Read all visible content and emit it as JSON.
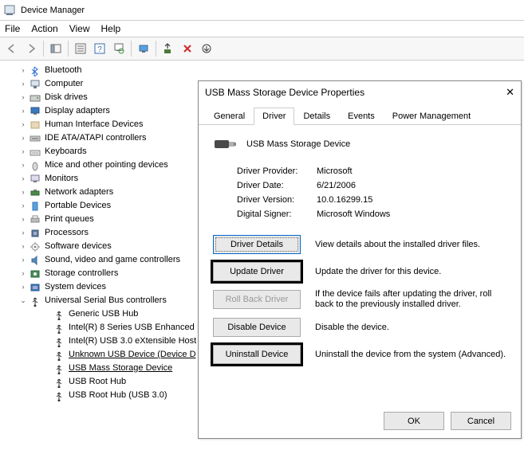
{
  "window": {
    "title": "Device Manager"
  },
  "menu": {
    "file": "File",
    "action": "Action",
    "view": "View",
    "help": "Help"
  },
  "tree": {
    "items": [
      {
        "label": "Bluetooth",
        "icon": "bluetooth"
      },
      {
        "label": "Computer",
        "icon": "computer"
      },
      {
        "label": "Disk drives",
        "icon": "disk"
      },
      {
        "label": "Display adapters",
        "icon": "display"
      },
      {
        "label": "Human Interface Devices",
        "icon": "hid"
      },
      {
        "label": "IDE ATA/ATAPI controllers",
        "icon": "ide"
      },
      {
        "label": "Keyboards",
        "icon": "keyboard"
      },
      {
        "label": "Mice and other pointing devices",
        "icon": "mouse"
      },
      {
        "label": "Monitors",
        "icon": "monitor"
      },
      {
        "label": "Network adapters",
        "icon": "network"
      },
      {
        "label": "Portable Devices",
        "icon": "portable"
      },
      {
        "label": "Print queues",
        "icon": "printer"
      },
      {
        "label": "Processors",
        "icon": "cpu"
      },
      {
        "label": "Software devices",
        "icon": "software"
      },
      {
        "label": "Sound, video and game controllers",
        "icon": "sound"
      },
      {
        "label": "Storage controllers",
        "icon": "storage"
      },
      {
        "label": "System devices",
        "icon": "system"
      }
    ],
    "usb": {
      "label": "Universal Serial Bus controllers",
      "children": [
        "Generic USB Hub",
        "Intel(R) 8 Series USB Enhanced",
        "Intel(R) USB 3.0 eXtensible Host",
        "Unknown USB Device (Device D",
        "USB Mass Storage Device",
        "USB Root Hub",
        "USB Root Hub (USB 3.0)"
      ]
    }
  },
  "dialog": {
    "title": "USB Mass Storage Device Properties",
    "tabs": {
      "general": "General",
      "driver": "Driver",
      "details": "Details",
      "events": "Events",
      "power": "Power Management"
    },
    "device_name": "USB Mass Storage Device",
    "info": {
      "provider_k": "Driver Provider:",
      "provider_v": "Microsoft",
      "date_k": "Driver Date:",
      "date_v": "6/21/2006",
      "version_k": "Driver Version:",
      "version_v": "10.0.16299.15",
      "signer_k": "Digital Signer:",
      "signer_v": "Microsoft Windows"
    },
    "actions": {
      "details": {
        "label": "Driver Details",
        "desc": "View details about the installed driver files."
      },
      "update": {
        "label": "Update Driver",
        "desc": "Update the driver for this device."
      },
      "rollback": {
        "label": "Roll Back Driver",
        "desc": "If the device fails after updating the driver, roll back to the previously installed driver."
      },
      "disable": {
        "label": "Disable Device",
        "desc": "Disable the device."
      },
      "uninstall": {
        "label": "Uninstall Device",
        "desc": "Uninstall the device from the system (Advanced)."
      }
    },
    "footer": {
      "ok": "OK",
      "cancel": "Cancel"
    }
  }
}
